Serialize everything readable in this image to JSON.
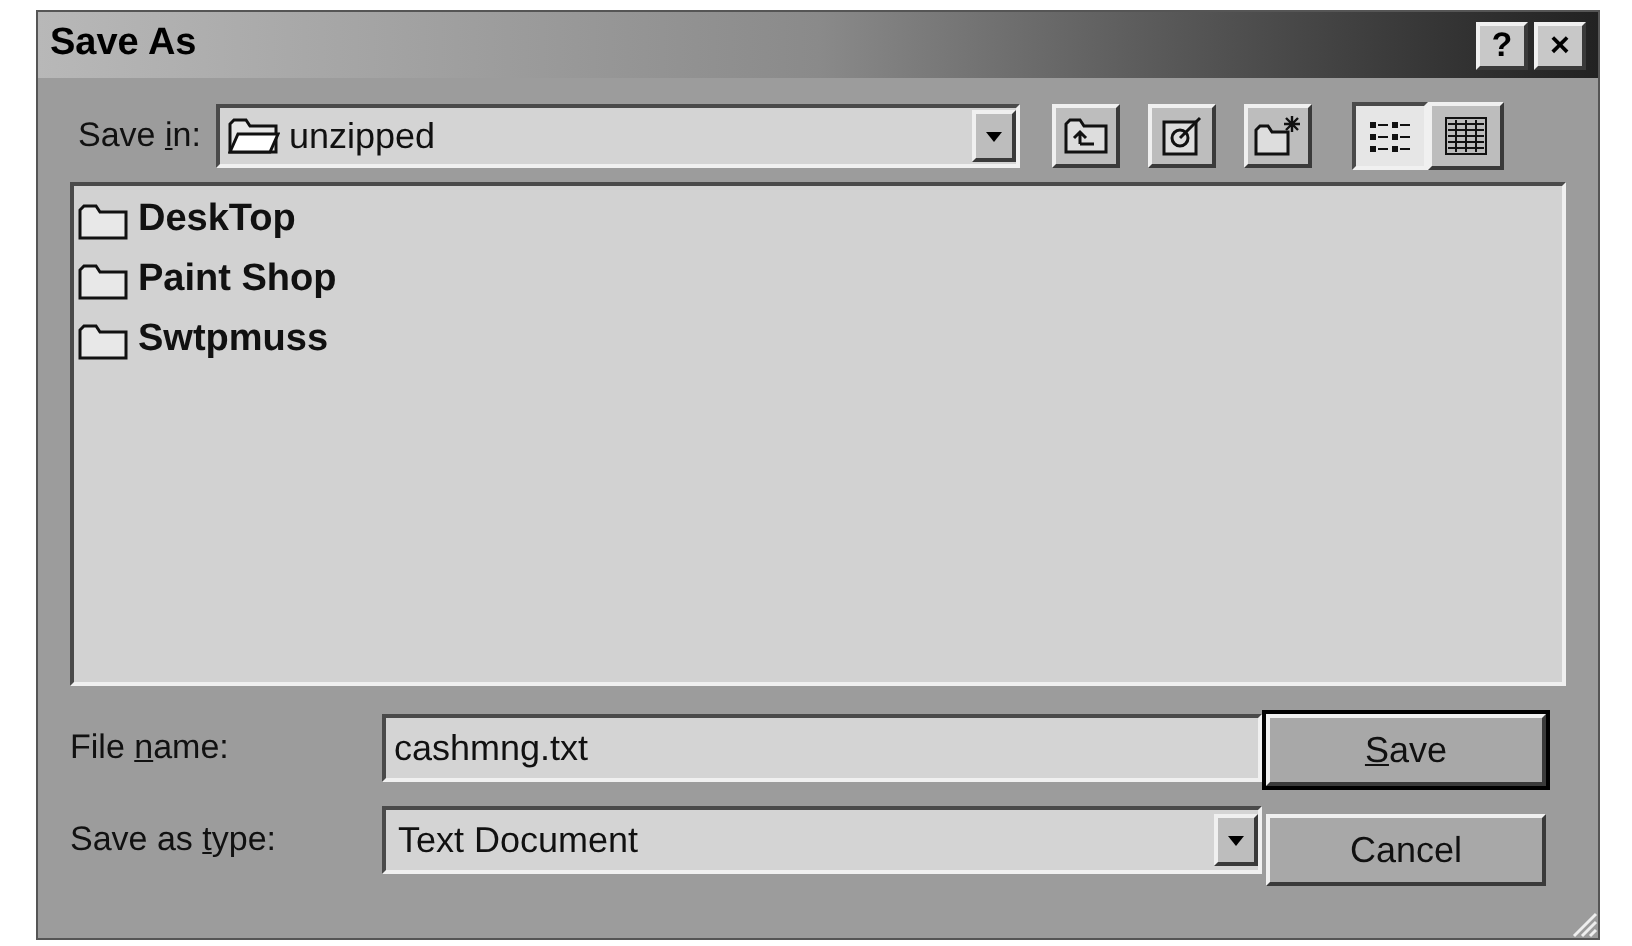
{
  "window": {
    "title": "Save As",
    "title_buttons": [
      "?",
      "×"
    ]
  },
  "save_in": {
    "label": {
      "before": "Save ",
      "key": "i",
      "after": "n:"
    },
    "value": "unzipped"
  },
  "view_buttons": [
    {
      "kind": "list",
      "selected": true
    },
    {
      "kind": "details",
      "selected": false
    }
  ],
  "files": [
    {
      "name": "DeskTop"
    },
    {
      "name": "Paint Shop"
    },
    {
      "name": "Swtpmuss"
    }
  ],
  "file_name": {
    "label": {
      "before": "File ",
      "key": "n",
      "after": "ame:"
    },
    "value": "cashmng.txt"
  },
  "save_as_type": {
    "label": {
      "before": "Save as ",
      "key": "t",
      "after": "ype:"
    },
    "value": "Text Document"
  },
  "buttons": [
    {
      "label": {
        "key": "S",
        "after": "ave"
      },
      "default": true
    },
    {
      "label": {
        "before": "Cancel"
      },
      "default": false
    }
  ]
}
